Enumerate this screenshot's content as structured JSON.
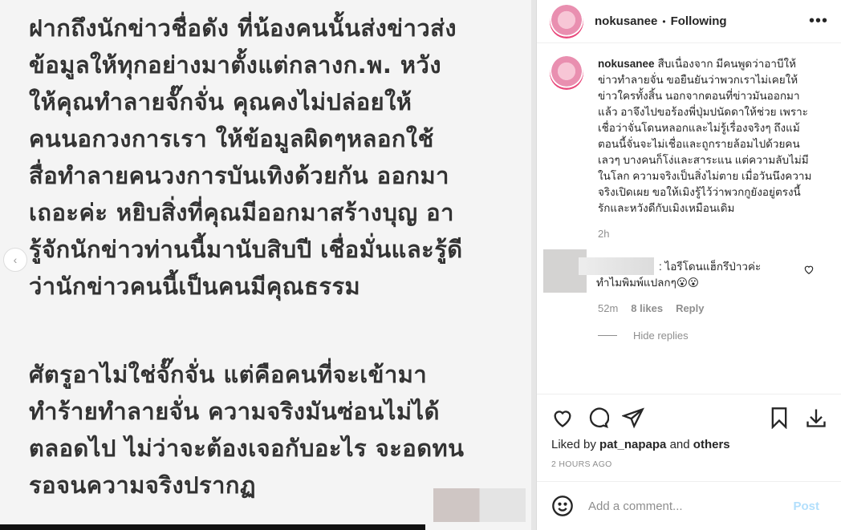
{
  "post_image": {
    "paragraph1": "ฝากถึงนักข่าวชื่อดัง ที่น้องคนนั้นส่งข่าวส่ง\nข้อมูลให้ทุกอย่างมาตั้งแต่กลางก.พ. หวัง\nให้คุณทำลายจั๊กจั่น คุณคงไม่ปล่อยให้\nคนนอกวงการเรา ให้ข้อมูลผิดๆหลอกใช้\nสื่อทำลายคนวงการบันเทิงด้วยกัน ออกมา\nเถอะค่ะ หยิบสิ่งที่คุณมีออกมาสร้างบุญ อา\nรู้จักนักข่าวท่านนี้มานับสิบปี เชื่อมั่นและรู้ดี\nว่านักข่าวคนนี้เป็นคนมีคุณธรรม",
    "paragraph2": "ศัตรูอาไม่ใช่จั๊กจั่น แต่คือคนที่จะเข้ามา\nทำร้ายทำลายจั่น ความจริงมันซ่อนไม่ได้\nตลอดไป ไม่ว่าจะต้องเจอกับอะไร จะอดทน\nรอจนความจริงปรากฏ",
    "prev_glyph": "‹"
  },
  "header": {
    "username": "nokusanee",
    "separator": "•",
    "follow_status": "Following",
    "more_glyph": "•••"
  },
  "caption": {
    "username": "nokusanee",
    "text": "สืบเนื่องจาก มีคนพูดว่าอาบีให้ข่าวทำลายจั่น ขอยืนยันว่าพวกเราไม่เคยให้ข่าวใครทั้งสิ้น นอกจากตอนที่ข่าวมันออกมาแล้ว อาจึงไปขอร้องพี่ปุ่มปนัดดาให้ช่วย เพราะเชื่อว่าจั่นโดนหลอกและไม่รู้เรื่องจริงๆ ถึงแม้ตอนนี้จั่นจะไม่เชื่อและถูกรายล้อมไปด้วยคนเลวๆ บางคนก็โง่และสาระแน แต่ความลับไม่มีในโลก ความจริงเป็นสิ่งไม่ตาย เมื่อวันนึงความจริงเปิดเผย ขอให้เมิงรู้ไว้ว่าพวกกูยังอยู่ตรงนี้ รักและหวังดีกับเมิงเหมือนเดิม",
    "time": "2h"
  },
  "comment": {
    "text_line1": ": ไอรีโดนแฮ็กรึป่าวค่ะ",
    "text_line2": "ทำไมพิมพ์แปลกๆ😮😮",
    "time": "52m",
    "likes": "8 likes",
    "reply": "Reply",
    "hide_replies": "Hide replies"
  },
  "actions": {
    "liked_prefix": "Liked by",
    "liked_user": "pat_napapa",
    "liked_and": "and",
    "liked_others": "others",
    "time_ago": "2 HOURS AGO"
  },
  "add_comment": {
    "placeholder": "Add a comment...",
    "post_label": "Post"
  }
}
